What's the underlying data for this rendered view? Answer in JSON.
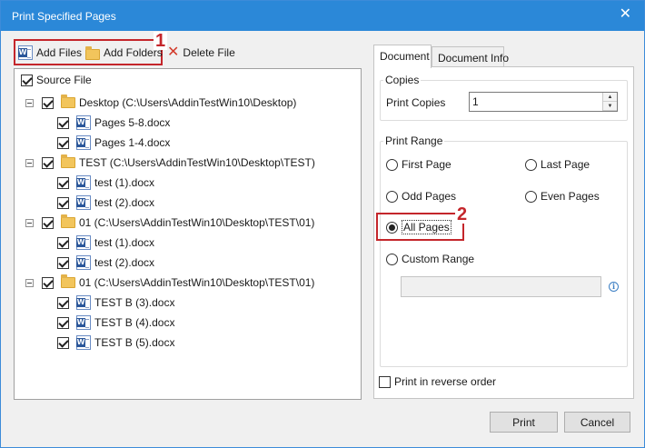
{
  "window": {
    "title": "Print Specified Pages",
    "close_glyph": "✕"
  },
  "toolbar": {
    "add_files": "Add Files",
    "add_folders": "Add Folders",
    "delete_file": "Delete File",
    "callout_1": "1"
  },
  "tree": {
    "root": {
      "label": "Source File",
      "checked": true
    },
    "items": [
      {
        "type": "folder",
        "label": "Desktop (C:\\Users\\AddinTestWin10\\Desktop)",
        "checked": true
      },
      {
        "type": "file",
        "label": "Pages 5-8.docx",
        "checked": true
      },
      {
        "type": "file",
        "label": "Pages 1-4.docx",
        "checked": true
      },
      {
        "type": "folder",
        "label": "TEST (C:\\Users\\AddinTestWin10\\Desktop\\TEST)",
        "checked": true
      },
      {
        "type": "file",
        "label": "test (1).docx",
        "checked": true
      },
      {
        "type": "file",
        "label": "test (2).docx",
        "checked": true
      },
      {
        "type": "folder",
        "label": "01 (C:\\Users\\AddinTestWin10\\Desktop\\TEST\\01)",
        "checked": true
      },
      {
        "type": "file",
        "label": "test (1).docx",
        "checked": true
      },
      {
        "type": "file",
        "label": "test (2).docx",
        "checked": true
      },
      {
        "type": "folder",
        "label": "01 (C:\\Users\\AddinTestWin10\\Desktop\\TEST\\01)",
        "checked": true
      },
      {
        "type": "file",
        "label": "TEST B (3).docx",
        "checked": true
      },
      {
        "type": "file",
        "label": "TEST B (4).docx",
        "checked": true
      },
      {
        "type": "file",
        "label": "TEST B (5).docx",
        "checked": true
      }
    ]
  },
  "tabs": [
    {
      "label": "Document",
      "active": true
    },
    {
      "label": "Document Info",
      "active": false
    }
  ],
  "copies": {
    "group_title": "Copies",
    "label": "Print Copies",
    "value": "1"
  },
  "print_range": {
    "group_title": "Print Range",
    "first_page": "First Page",
    "last_page": "Last Page",
    "odd_pages": "Odd Pages",
    "even_pages": "Even Pages",
    "all_pages": "All Pages",
    "custom_range": "Custom Range",
    "selected": "all_pages",
    "custom_range_value": "",
    "callout_2": "2"
  },
  "reverse_order": {
    "label": "Print in reverse order",
    "checked": false
  },
  "buttons": {
    "print": "Print",
    "cancel": "Cancel"
  },
  "colors": {
    "titlebar": "#2b88d8",
    "highlight": "#c4262b"
  },
  "icons": {
    "file": "word-document-icon",
    "folder": "folder-icon",
    "delete": "red-x-delete-icon",
    "info": "info-icon"
  }
}
